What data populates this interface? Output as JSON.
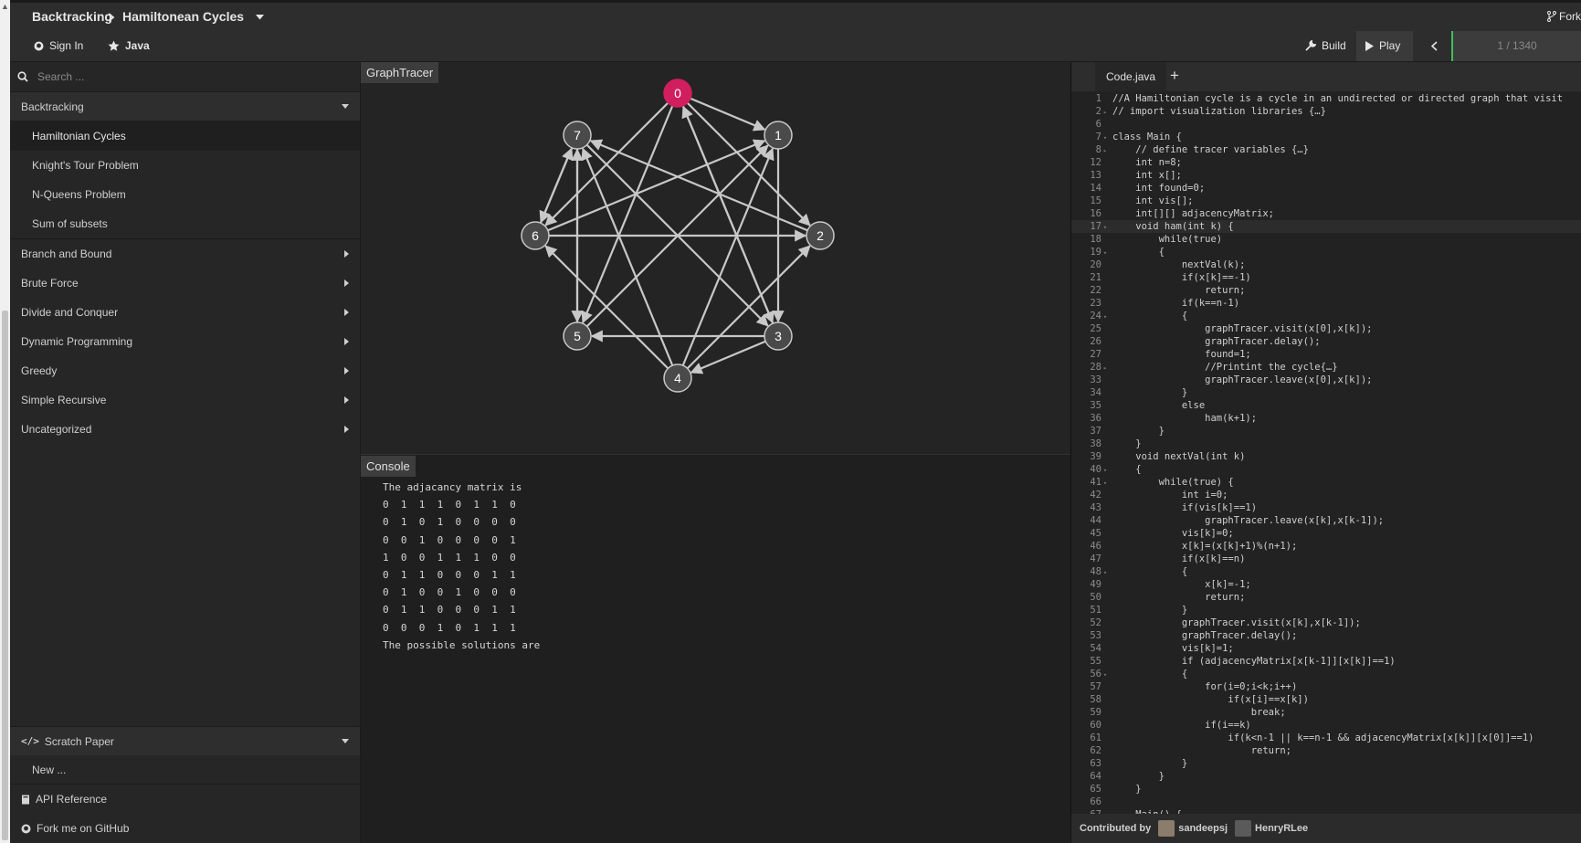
{
  "header": {
    "category": "Backtracking",
    "algorithm": "Hamiltonean Cycles",
    "fork_label": "Fork"
  },
  "toolbar": {
    "sign_in": "Sign In",
    "language": "Java",
    "build": "Build",
    "play": "Play",
    "progress": "1 / 1340"
  },
  "sidebar": {
    "search_placeholder": "Search ...",
    "open_category": "Backtracking",
    "sub_items": [
      "Hamiltonian Cycles",
      "Knight's Tour Problem",
      "N-Queens Problem",
      "Sum of subsets"
    ],
    "categories": [
      "Branch and Bound",
      "Brute Force",
      "Divide and Conquer",
      "Dynamic Programming",
      "Greedy",
      "Simple Recursive",
      "Uncategorized"
    ],
    "scratch_paper": "Scratch Paper",
    "new_item": "New ...",
    "api_reference": "API Reference",
    "fork_github": "Fork me on GitHub"
  },
  "tracer": {
    "title": "GraphTracer",
    "nodes": [
      "0",
      "1",
      "2",
      "3",
      "4",
      "5",
      "6",
      "7"
    ],
    "active_node": "0",
    "colors": {
      "active": "#d11e5f",
      "node": "#4a4a4a",
      "edge": "#c8c8c8"
    }
  },
  "console": {
    "title": "Console",
    "lines": [
      "The adjacancy matrix is",
      "0  1  1  1  0  1  1  0",
      "0  1  0  1  0  0  0  0",
      "0  0  1  0  0  0  0  1",
      "1  0  0  1  1  1  0  0",
      "0  1  1  0  0  0  1  1",
      "0  1  0  0  1  0  0  0",
      "0  1  1  0  0  0  1  1",
      "0  0  0  1  0  1  1  1",
      "The possible solutions are"
    ]
  },
  "code_panel": {
    "tab": "Code.java",
    "lines": [
      {
        "n": "1",
        "t": "//A Hamiltonian cycle is a cycle in an undirected or directed graph that visit"
      },
      {
        "n": "2",
        "t": "// import visualization libraries {…}",
        "f": "▸"
      },
      {
        "n": "6",
        "t": ""
      },
      {
        "n": "7",
        "t": "class Main {",
        "f": "▾"
      },
      {
        "n": "8",
        "t": "    // define tracer variables {…}",
        "f": "▸"
      },
      {
        "n": "12",
        "t": "    int n=8;"
      },
      {
        "n": "13",
        "t": "    int x[];"
      },
      {
        "n": "14",
        "t": "    int found=0;"
      },
      {
        "n": "15",
        "t": "    int vis[];"
      },
      {
        "n": "16",
        "t": "    int[][] adjacencyMatrix;"
      },
      {
        "n": "17",
        "t": "    void ham(int k) {",
        "f": "▾"
      },
      {
        "n": "18",
        "t": "        while(true)"
      },
      {
        "n": "19",
        "t": "        {",
        "f": "▾"
      },
      {
        "n": "20",
        "t": "            nextVal(k);"
      },
      {
        "n": "21",
        "t": "            if(x[k]==-1)"
      },
      {
        "n": "22",
        "t": "                return;"
      },
      {
        "n": "23",
        "t": "            if(k==n-1)"
      },
      {
        "n": "24",
        "t": "            {",
        "f": "▾"
      },
      {
        "n": "25",
        "t": "                graphTracer.visit(x[0],x[k]);"
      },
      {
        "n": "26",
        "t": "                graphTracer.delay();"
      },
      {
        "n": "27",
        "t": "                found=1;"
      },
      {
        "n": "28",
        "t": "                //Printint the cycle{…}",
        "f": "▸"
      },
      {
        "n": "33",
        "t": "                graphTracer.leave(x[0],x[k]);"
      },
      {
        "n": "34",
        "t": "            }"
      },
      {
        "n": "35",
        "t": "            else"
      },
      {
        "n": "36",
        "t": "                ham(k+1);"
      },
      {
        "n": "37",
        "t": "        }"
      },
      {
        "n": "38",
        "t": "    }"
      },
      {
        "n": "39",
        "t": "    void nextVal(int k)"
      },
      {
        "n": "40",
        "t": "    {",
        "f": "▾"
      },
      {
        "n": "41",
        "t": "        while(true) {",
        "f": "▾"
      },
      {
        "n": "42",
        "t": "            int i=0;"
      },
      {
        "n": "43",
        "t": "            if(vis[k]==1)"
      },
      {
        "n": "44",
        "t": "                graphTracer.leave(x[k],x[k-1]);"
      },
      {
        "n": "45",
        "t": "            vis[k]=0;"
      },
      {
        "n": "46",
        "t": "            x[k]=(x[k]+1)%(n+1);"
      },
      {
        "n": "47",
        "t": "            if(x[k]==n)"
      },
      {
        "n": "48",
        "t": "            {",
        "f": "▾"
      },
      {
        "n": "49",
        "t": "                x[k]=-1;"
      },
      {
        "n": "50",
        "t": "                return;"
      },
      {
        "n": "51",
        "t": "            }"
      },
      {
        "n": "52",
        "t": "            graphTracer.visit(x[k],x[k-1]);"
      },
      {
        "n": "53",
        "t": "            graphTracer.delay();"
      },
      {
        "n": "54",
        "t": "            vis[k]=1;"
      },
      {
        "n": "55",
        "t": "            if (adjacencyMatrix[x[k-1]][x[k]]==1)"
      },
      {
        "n": "56",
        "t": "            {",
        "f": "▾"
      },
      {
        "n": "57",
        "t": "                for(i=0;i<k;i++)"
      },
      {
        "n": "58",
        "t": "                    if(x[i]==x[k])"
      },
      {
        "n": "59",
        "t": "                        break;"
      },
      {
        "n": "60",
        "t": "                if(i==k)"
      },
      {
        "n": "61",
        "t": "                    if(k<n-1 || k==n-1 && adjacencyMatrix[x[k]][x[0]]==1)"
      },
      {
        "n": "62",
        "t": "                        return;"
      },
      {
        "n": "63",
        "t": "            }"
      },
      {
        "n": "64",
        "t": "        }"
      },
      {
        "n": "65",
        "t": "    }"
      },
      {
        "n": "66",
        "t": ""
      },
      {
        "n": "67",
        "t": "    Main() {",
        "f": "▾"
      }
    ],
    "current_line": "17"
  },
  "footer": {
    "contributed_by": "Contributed by",
    "contributors": [
      "sandeepsj",
      "HenryRLee"
    ]
  }
}
